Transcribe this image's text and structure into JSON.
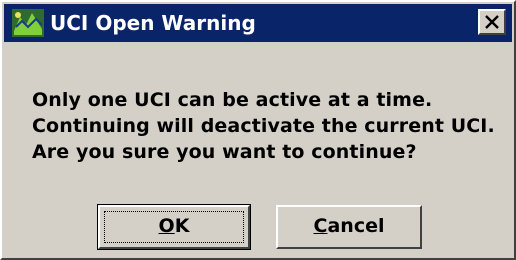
{
  "window": {
    "title": "UCI Open Warning",
    "app_icon": "globe-icon",
    "close_icon": "close-icon"
  },
  "message": {
    "lines": [
      "Only one UCI can be active at a time.",
      "Continuing will deactivate the current UCI.",
      "Are you sure you want to continue?"
    ]
  },
  "buttons": {
    "ok_label": "OK",
    "cancel_label": "Cancel"
  },
  "colors": {
    "titlebar": "#0a246a",
    "face": "#d4d0c8",
    "text": "#000000"
  }
}
